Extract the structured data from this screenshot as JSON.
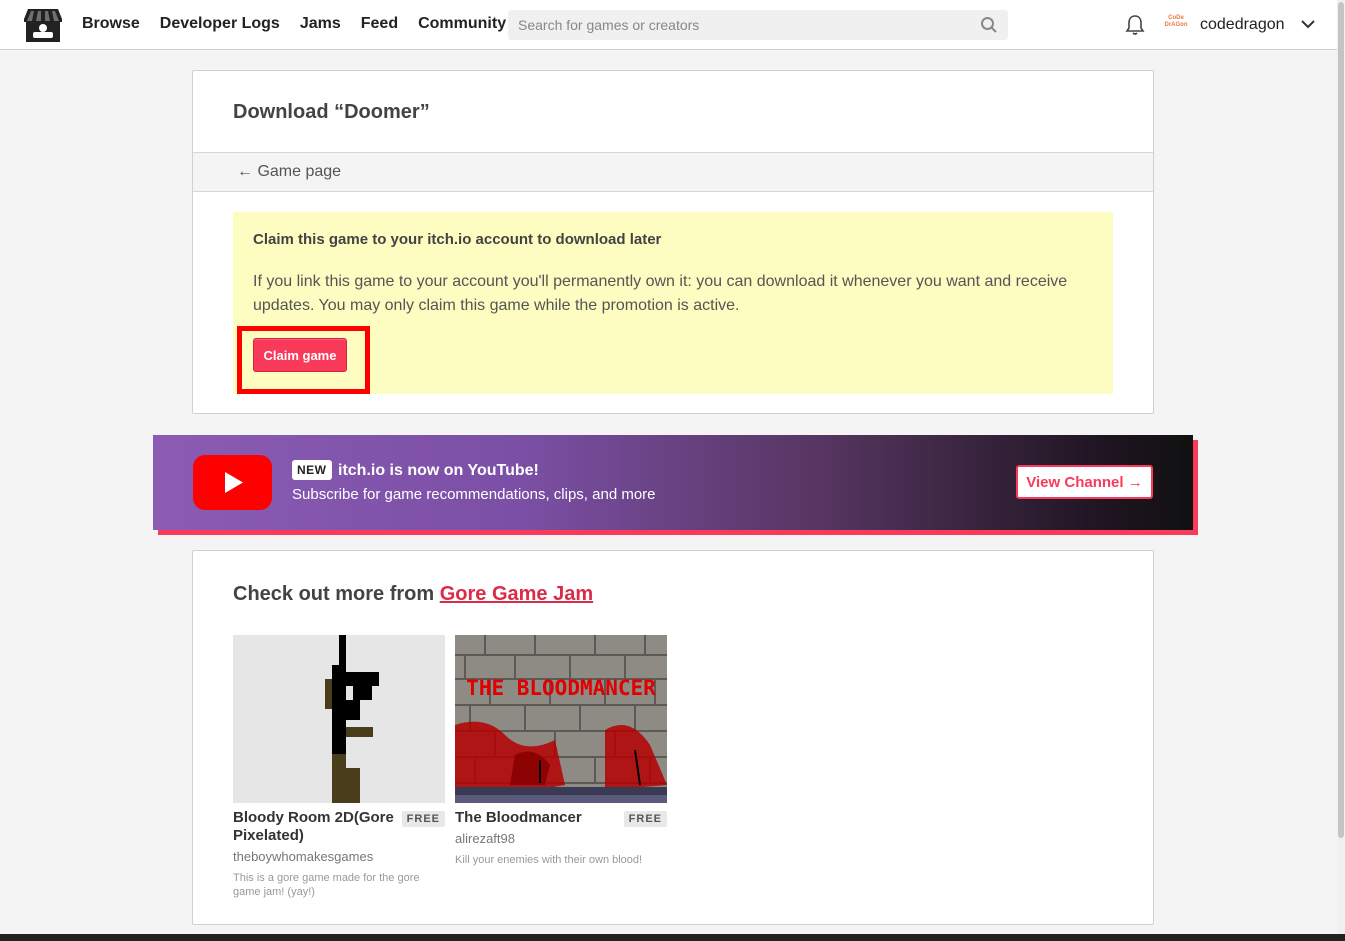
{
  "nav": {
    "browse": "Browse",
    "devlogs": "Developer Logs",
    "jams": "Jams",
    "feed": "Feed",
    "community": "Community"
  },
  "search": {
    "placeholder": "Search for games or creators"
  },
  "user": {
    "name": "codedragon",
    "avatar_text": "CoDe DrAGon"
  },
  "download": {
    "title_prefix": "Download “",
    "game_name": "Doomer",
    "title_suffix": "”",
    "back_link": "← Game page",
    "claim_heading": "Claim this game to your itch.io account to download later",
    "claim_text": "If you link this game to your account you'll permanently own it: you can download it whenever you want and receive updates. You may only claim this game while the promotion is active.",
    "claim_button": "Claim game"
  },
  "youtube": {
    "badge": "NEW",
    "title": "itch.io is now on YouTube!",
    "subtitle": "Subscribe for game recommendations, clips, and more",
    "button": "View Channel →"
  },
  "more": {
    "heading": "Check out more from ",
    "jam_link": "Gore Game Jam",
    "games": [
      {
        "title": "Bloody Room 2D(Gore Pixelated)",
        "price": "FREE",
        "author": "theboywhomakesgames",
        "description": "This is a gore game made for the gore game jam! (yay!)"
      },
      {
        "title": "The Bloodmancer",
        "price": "FREE",
        "author": "alirezaft98",
        "description": "Kill your enemies with their own blood!",
        "thumb_text": "THE BLOODMANCER"
      }
    ]
  },
  "colors": {
    "accent": "#fa3a5b",
    "claim_bg": "#fdfcc1",
    "jam_link": "#da2c49"
  }
}
